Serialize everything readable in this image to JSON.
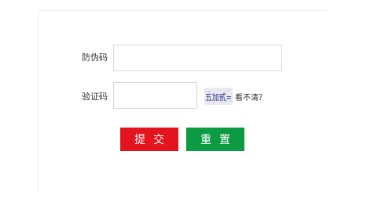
{
  "form": {
    "anticounterfeit_label": "防伪码",
    "anticounterfeit_value": "",
    "verify_label": "验证码",
    "verify_value": "",
    "captcha_text": "五加贰=",
    "refresh_text": "看不清？",
    "submit_label": "提交",
    "reset_label": "重置"
  },
  "colors": {
    "submit_bg": "#e4141e",
    "reset_bg": "#0c9a43",
    "captcha_text": "#2b3a8f"
  }
}
